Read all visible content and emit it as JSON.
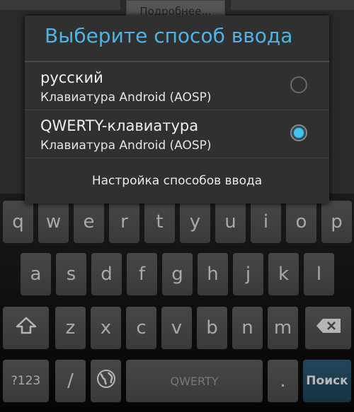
{
  "background": {
    "partial_button_label": "Подробнее..."
  },
  "dialog": {
    "title": "Выберите способ ввода",
    "options": [
      {
        "name": "русский",
        "subtitle": "Клавиатура Android (AOSP)",
        "selected": false
      },
      {
        "name": "QWERTY-клавиатура",
        "subtitle": "Клавиатура Android (AOSP)",
        "selected": true
      }
    ],
    "settings_label": "Настройка способов ввода",
    "accent_color": "#4fb4e4"
  },
  "keyboard": {
    "row1": [
      "q",
      "w",
      "e",
      "r",
      "t",
      "y",
      "u",
      "i",
      "o",
      "p"
    ],
    "row2": [
      "a",
      "s",
      "d",
      "f",
      "g",
      "h",
      "j",
      "k",
      "l"
    ],
    "row3": [
      "z",
      "x",
      "c",
      "v",
      "b",
      "n",
      "m"
    ],
    "shift_icon": "shift-arrow-icon",
    "backspace_icon": "backspace-icon",
    "symbols_label": "?123",
    "slash_label": "/",
    "globe_icon": "globe-icon",
    "space_label": "QWERTY",
    "period_label": ".",
    "search_label": "Поиск"
  }
}
